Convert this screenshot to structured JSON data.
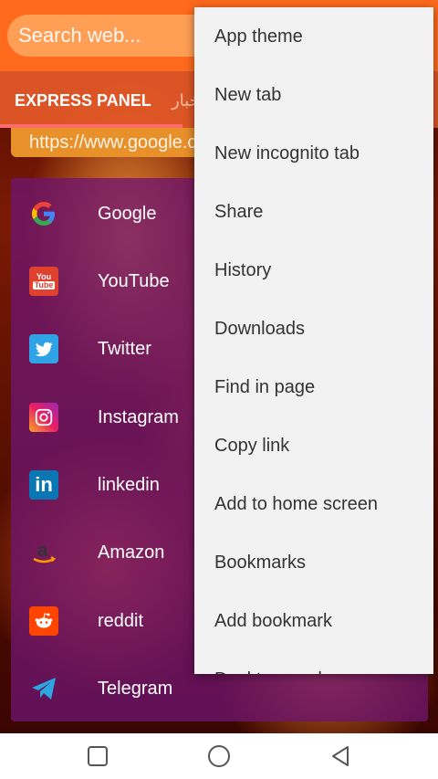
{
  "header": {
    "search_placeholder": "Search web...",
    "tabs": [
      "EXPRESS PANEL",
      "أخبار"
    ],
    "url": "https://www.google.com"
  },
  "sites": [
    {
      "label": "Google",
      "icon": "google-icon"
    },
    {
      "label": "YouTube",
      "icon": "youtube-icon"
    },
    {
      "label": "Twitter",
      "icon": "twitter-icon"
    },
    {
      "label": "Instagram",
      "icon": "instagram-icon"
    },
    {
      "label": "linkedin",
      "icon": "linkedin-icon"
    },
    {
      "label": "Amazon",
      "icon": "amazon-icon"
    },
    {
      "label": "reddit",
      "icon": "reddit-icon"
    },
    {
      "label": "Telegram",
      "icon": "telegram-icon"
    }
  ],
  "menu": {
    "items": [
      "App theme",
      "New tab",
      "New incognito tab",
      "Share",
      "History",
      "Downloads",
      "Find in page",
      "Copy link",
      "Add to home screen",
      "Bookmarks",
      "Add bookmark",
      "Desktop mode"
    ]
  },
  "colors": {
    "toolbar": "#ff6a1c",
    "panel": "#6e146e",
    "menu_bg": "#f2f2f2"
  }
}
